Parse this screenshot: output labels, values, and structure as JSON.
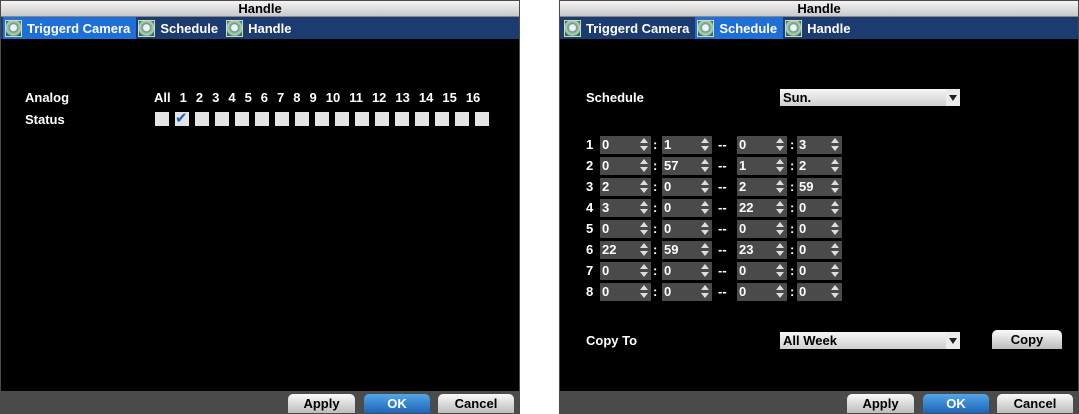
{
  "left": {
    "title": "Handle",
    "tabs": [
      "Triggerd Camera",
      "Schedule",
      "Handle"
    ],
    "active_tab": 0,
    "analog_label": "Analog",
    "status_label": "Status",
    "all_label": "All",
    "cameras": [
      "1",
      "2",
      "3",
      "4",
      "5",
      "6",
      "7",
      "8",
      "9",
      "10",
      "11",
      "12",
      "13",
      "14",
      "15",
      "16"
    ],
    "checked": [
      false,
      true,
      false,
      false,
      false,
      false,
      false,
      false,
      false,
      false,
      false,
      false,
      false,
      false,
      false,
      false,
      false
    ],
    "buttons": {
      "apply": "Apply",
      "ok": "OK",
      "cancel": "Cancel"
    }
  },
  "right": {
    "title": "Handle",
    "tabs": [
      "Triggerd Camera",
      "Schedule",
      "Handle"
    ],
    "active_tab": 1,
    "schedule_label": "Schedule",
    "schedule_value": "Sun.",
    "rows": [
      {
        "n": "1",
        "sh": "0",
        "sm": "1",
        "eh": "0",
        "em": "3"
      },
      {
        "n": "2",
        "sh": "0",
        "sm": "57",
        "eh": "1",
        "em": "2"
      },
      {
        "n": "3",
        "sh": "2",
        "sm": "0",
        "eh": "2",
        "em": "59"
      },
      {
        "n": "4",
        "sh": "3",
        "sm": "0",
        "eh": "22",
        "em": "0"
      },
      {
        "n": "5",
        "sh": "0",
        "sm": "0",
        "eh": "0",
        "em": "0"
      },
      {
        "n": "6",
        "sh": "22",
        "sm": "59",
        "eh": "23",
        "em": "0"
      },
      {
        "n": "7",
        "sh": "0",
        "sm": "0",
        "eh": "0",
        "em": "0"
      },
      {
        "n": "8",
        "sh": "0",
        "sm": "0",
        "eh": "0",
        "em": "0"
      }
    ],
    "colon": ":",
    "dash": "--",
    "copy_to_label": "Copy To",
    "copy_to_value": "All Week",
    "copy_button": "Copy",
    "buttons": {
      "apply": "Apply",
      "ok": "OK",
      "cancel": "Cancel"
    }
  }
}
